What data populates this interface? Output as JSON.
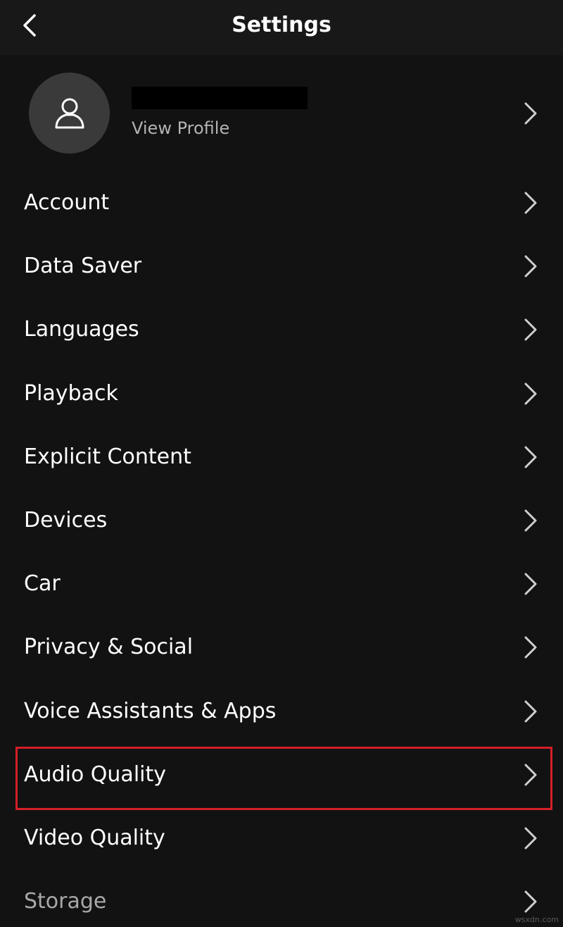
{
  "header": {
    "title": "Settings",
    "back_icon": "chevron-left-icon"
  },
  "profile": {
    "avatar_icon": "user-icon",
    "name_redacted": true,
    "subtitle": "View Profile"
  },
  "menu": {
    "items": [
      {
        "label": "Account"
      },
      {
        "label": "Data Saver"
      },
      {
        "label": "Languages"
      },
      {
        "label": "Playback"
      },
      {
        "label": "Explicit Content"
      },
      {
        "label": "Devices"
      },
      {
        "label": "Car"
      },
      {
        "label": "Privacy & Social"
      },
      {
        "label": "Voice Assistants & Apps"
      },
      {
        "label": "Audio Quality",
        "highlighted": true
      },
      {
        "label": "Video Quality"
      },
      {
        "label": "Storage"
      }
    ]
  },
  "colors": {
    "background": "#121212",
    "header": "#181818",
    "highlight": "#d41f26",
    "subtitle": "#b3b3b3"
  },
  "watermark": "wsxdn.com"
}
